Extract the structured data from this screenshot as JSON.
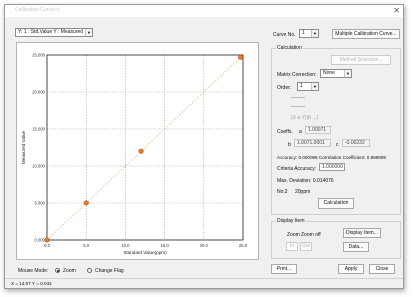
{
  "window": {
    "title": "Calibration Curve(s)",
    "close_glyph": "✕"
  },
  "toolbar": {
    "plot_selector": "Y: 1 : Std.Value Y : Measured"
  },
  "curve": {
    "label": "Curve No.",
    "value": "1",
    "multiple_button": "Multiple Calibration Curve..."
  },
  "calculation": {
    "group_title": "Calculation",
    "method_button": "Method Selection...",
    "matrix_label": "Matrix Correction:",
    "matrix_value": "None",
    "order_label": "Order:",
    "order_value": "1",
    "equation": "(X  a  Y)(b ...)",
    "coeffs_label": "Coeffs.",
    "coeff_a_label": "a",
    "coeff_a_value": "1.00071",
    "coeff_b_label": "b",
    "coeff_b_value": "1.0071.0001",
    "coeff_c_label": "c",
    "coeff_c_value": "-0.00232",
    "accuracy_text": "Accuracy: 0.000089    Correlation Coefficient: 0.999999",
    "criteria_label": "Criteria Accuracy:",
    "criteria_value": "1.000000",
    "max_deviation_text": "Max. Deviation:  0.014076",
    "no2_label": "No.2",
    "no2_value": "20ppm",
    "calc_button": "Calculation"
  },
  "display_item": {
    "group_title": "Display Item",
    "zoom_label": "Zoom",
    "zoom_off_label": "Zoom off",
    "display_item_button": "Display Item...",
    "zoom_in_button": "In",
    "zoom_out_button": "Out",
    "data_button": "Data..."
  },
  "mouse_mode": {
    "label": "Mouse Mode:",
    "zoom_label": "Zoom",
    "change_flag_label": "Change Flag",
    "selected": "Zoom"
  },
  "footer": {
    "print_button": "Print...",
    "apply_button": "Apply",
    "close_button": "Close",
    "status": "X = 14.07  Y = 0.034"
  },
  "chart_data": {
    "type": "scatter",
    "xlabel": "Standard Value(ppm)",
    "ylabel": "Measured Value",
    "xlim": [
      0,
      25
    ],
    "ylim": [
      0,
      25
    ],
    "x_ticks": [
      "0.0",
      "5.0",
      "10.0",
      "15.0",
      "20.0",
      "25.0"
    ],
    "y_ticks": [
      "0.000",
      "5.000",
      "10.000",
      "15.000",
      "20.000",
      "25.000"
    ],
    "grid": true,
    "points": [
      {
        "x": 0.0,
        "y": 0.0
      },
      {
        "x": 5.0,
        "y": 5.0
      },
      {
        "x": 12.0,
        "y": 12.0
      },
      {
        "x": 24.7,
        "y": 24.7
      }
    ],
    "fit_line": [
      [
        0,
        0
      ],
      [
        25,
        25
      ]
    ],
    "colors": {
      "point": "#e8821e",
      "point_outline": "#c23a1a",
      "fit_line": "#f2b288",
      "grid": "#9a9a9a",
      "axis": "#222222"
    }
  }
}
